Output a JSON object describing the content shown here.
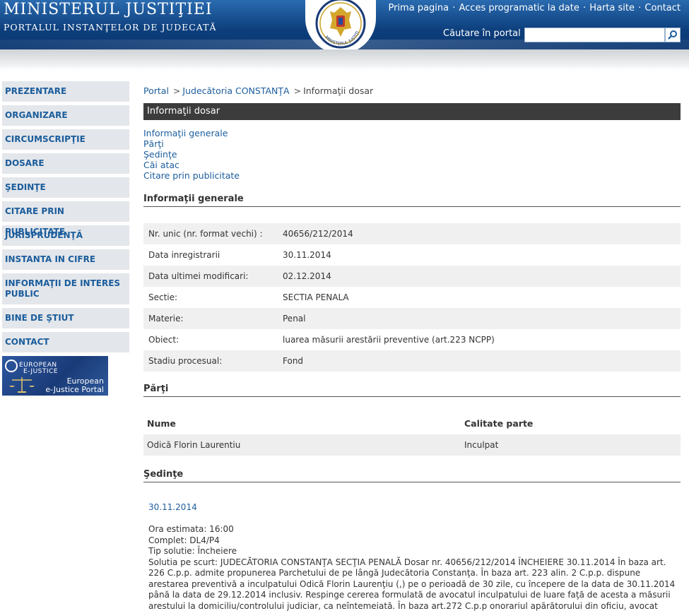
{
  "header": {
    "title": "MINISTERUL JUSTIŢIEI",
    "subtitle": "PORTALUL INSTANŢELOR DE JUDECATĂ",
    "emblem_text": "MINISTERUL JUSTIŢIEI",
    "top_links": [
      "Prima pagina",
      "Acces programatic la date",
      "Harta site",
      "Contact"
    ],
    "search_label": "Căutare în portal",
    "search_value": "",
    "search_icon": "magnifier-icon",
    "colors": {
      "header_blue": "#0d3f7c",
      "link_blue": "#1b5d9c",
      "bar_dark": "#3c3c3c"
    }
  },
  "sidebar": {
    "items": [
      {
        "label": "PREZENTARE"
      },
      {
        "label": "ORGANIZARE"
      },
      {
        "label": "CIRCUMSCRIPŢIE"
      },
      {
        "label": "DOSARE"
      },
      {
        "label": "ŞEDINŢE"
      },
      {
        "label": "CITARE PRIN PUBLICITATE"
      },
      {
        "label": "JURISPRUDENŢĂ"
      },
      {
        "label": "INSTANTA IN CIFRE"
      },
      {
        "label": "INFORMAŢII DE INTERES PUBLIC"
      },
      {
        "label": "BINE DE ŞTIUT"
      },
      {
        "label": "CONTACT"
      }
    ],
    "ejustice": {
      "line1": "EUROPEAN",
      "line2": "E-JUSTICE",
      "line3": "European",
      "line4": "e-Justice Portal"
    }
  },
  "breadcrumb": {
    "items": [
      "Portal",
      "Judecătoria CONSTANŢA",
      "Informaţii dosar"
    ],
    "separator": ">"
  },
  "section_bar": "Informaţii dosar",
  "anchor_links": [
    "Informaţii generale",
    "Părţi",
    "Şedinţe",
    "Căi atac",
    "Citare prin publicitate"
  ],
  "info_general": {
    "heading": "Informaţii generale",
    "rows": [
      {
        "label": "Nr. unic (nr. format vechi) :",
        "value": "40656/212/2014"
      },
      {
        "label": "Data inregistrarii",
        "value": "30.11.2014"
      },
      {
        "label": "Data ultimei modificari:",
        "value": "02.12.2014"
      },
      {
        "label": "Sectie:",
        "value": "SECTIA PENALA"
      },
      {
        "label": "Materie:",
        "value": "Penal"
      },
      {
        "label": "Obiect:",
        "value": "luarea măsurii arestării preventive (art.223 NCPP)"
      },
      {
        "label": "Stadiu procesual:",
        "value": "Fond"
      }
    ]
  },
  "parti": {
    "heading": "Părţi",
    "columns": [
      "Nume",
      "Calitate parte"
    ],
    "rows": [
      {
        "name": "Odică Florin Laurentiu",
        "role": "Inculpat"
      }
    ]
  },
  "sedinte": {
    "heading": "Şedinţe",
    "date": "30.11.2014",
    "ora_line": "Ora estimata: 16:00",
    "complet_line": "Complet: DL4/P4",
    "tip_line": "Tip solutie: Încheiere",
    "solutie_line": "Solutia pe scurt: JUDECĂTORIA CONSTANŢA SECŢIA PENALĂ Dosar nr. 40656/212/2014 ÎNCHEIERE 30.11.2014 În baza art. 226 C.p.p. admite propunerea Parchetului de pe lângă Judecătoria Constanţa. În baza art. 223 alin. 2 C.p.p. dispune arestarea preventivă a inculpatului Odică Florin Laurenţiu (,) pe o perioadă de 30 zile, cu începere de la data de 30.11.2014 până la data de 29.12.2014 inclusiv. Respinge cererea formulată de avocatul inculpatului de luare faţă de acesta a măsurii arestului la domiciliu/controlului judiciar, ca neîntemeiată. În baza art.272 C.p.p onorariul apărătorului din oficiu, avocat Detescu Ana Maria, în"
  }
}
